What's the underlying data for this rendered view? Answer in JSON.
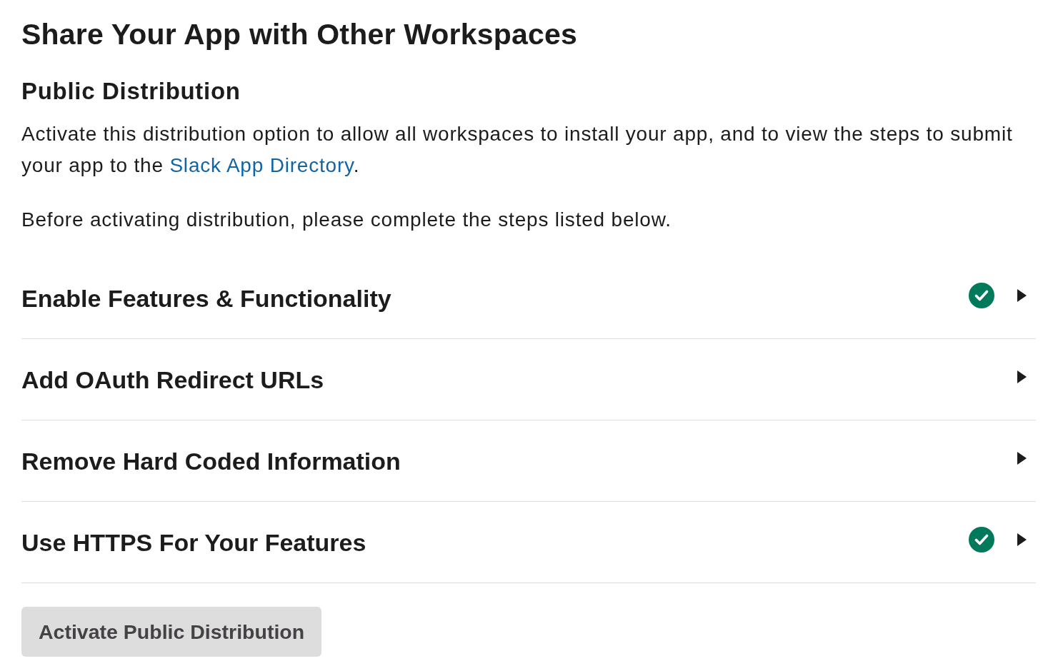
{
  "page": {
    "title": "Share Your App with Other Workspaces"
  },
  "section": {
    "heading": "Public Distribution",
    "description": [
      {
        "kind": "text",
        "text": "Activate this distribution option to allow all workspaces to install your app, and to view the steps to submit your app to the "
      },
      {
        "kind": "link",
        "text": "Slack App Directory"
      },
      {
        "kind": "text",
        "text": "."
      }
    ],
    "note": "Before activating distribution, please complete the steps listed below."
  },
  "steps": [
    {
      "title": "Enable Features & Functionality",
      "completed": true,
      "expanded": false
    },
    {
      "title": "Add OAuth Redirect URLs",
      "completed": false,
      "expanded": false
    },
    {
      "title": "Remove Hard Coded Information",
      "completed": false,
      "expanded": false
    },
    {
      "title": "Use HTTPS For Your Features",
      "completed": true,
      "expanded": false
    }
  ],
  "action_button": {
    "label": "Activate Public Distribution",
    "disabled": true
  }
}
